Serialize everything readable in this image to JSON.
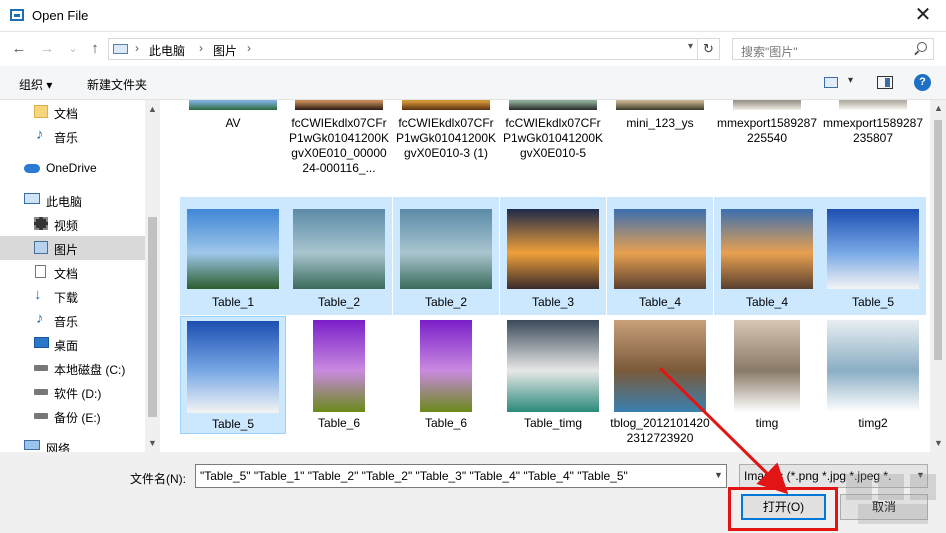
{
  "window": {
    "title": "Open File",
    "close_glyph": "✕"
  },
  "nav": {
    "back": "←",
    "forward": "→",
    "history": "⌄",
    "up": "↑",
    "breadcrumb": [
      "此电脑",
      "图片"
    ],
    "separator": "›",
    "refresh": "↻",
    "search_placeholder": "搜索\"图片\""
  },
  "toolbar": {
    "organize": "组织 ▾",
    "new_folder": "新建文件夹",
    "help": "?"
  },
  "sidebar": {
    "items": [
      {
        "label": "文档",
        "icon": "folder-icon"
      },
      {
        "label": "音乐",
        "icon": "music-note-icon"
      },
      {
        "label": "OneDrive",
        "icon": "cloud-icon"
      },
      {
        "label": "此电脑",
        "icon": "computer-icon"
      },
      {
        "label": "视频",
        "icon": "video-icon"
      },
      {
        "label": "图片",
        "icon": "pictures-icon"
      },
      {
        "label": "文档",
        "icon": "document-icon"
      },
      {
        "label": "下载",
        "icon": "download-icon"
      },
      {
        "label": "音乐",
        "icon": "music-note-icon"
      },
      {
        "label": "桌面",
        "icon": "desktop-icon"
      },
      {
        "label": "本地磁盘 (C:)",
        "icon": "drive-icon"
      },
      {
        "label": "软件 (D:)",
        "icon": "drive-icon"
      },
      {
        "label": "备份 (E:)",
        "icon": "drive-icon"
      },
      {
        "label": "网络",
        "icon": "network-icon"
      }
    ]
  },
  "files": {
    "row1": [
      {
        "name": "AV"
      },
      {
        "name": "fcCWIEkdlx07CFrP1wGk01041200KgvX0E010_0000024-000116_..."
      },
      {
        "name": "fcCWIEkdlx07CFrP1wGk01041200KgvX0E010-3 (1)"
      },
      {
        "name": "fcCWIEkdlx07CFrP1wGk01041200KgvX0E010-5"
      },
      {
        "name": "mini_123_ys"
      },
      {
        "name": "mmexport1589287225540"
      },
      {
        "name": "mmexport1589287235807"
      }
    ],
    "row2": [
      {
        "name": "Table_1",
        "selected": true
      },
      {
        "name": "Table_2",
        "selected": true
      },
      {
        "name": "Table_2",
        "selected": true
      },
      {
        "name": "Table_3",
        "selected": true
      },
      {
        "name": "Table_4",
        "selected": true
      },
      {
        "name": "Table_4",
        "selected": true
      },
      {
        "name": "Table_5",
        "selected": true
      }
    ],
    "row3": [
      {
        "name": "Table_5",
        "selected": true
      },
      {
        "name": "Table_6",
        "selected": false
      },
      {
        "name": "Table_6",
        "selected": false
      },
      {
        "name": "Table_timg",
        "selected": false
      },
      {
        "name": "tblog_20121014202312723920",
        "selected": false
      },
      {
        "name": "timg",
        "selected": false
      },
      {
        "name": "timg2",
        "selected": false
      }
    ]
  },
  "footer": {
    "filename_label": "文件名(N):",
    "filename_value": "\"Table_5\" \"Table_1\" \"Table_2\" \"Table_2\" \"Table_3\" \"Table_4\" \"Table_4\" \"Table_5\"",
    "filetype_value": "Images (*.png *.jpg *.jpeg *.",
    "open_label": "打开(O)",
    "cancel_label": "取消"
  },
  "colors": {
    "selection": "#cce8ff",
    "accent": "#0078d7",
    "annotation": "#e31414"
  }
}
